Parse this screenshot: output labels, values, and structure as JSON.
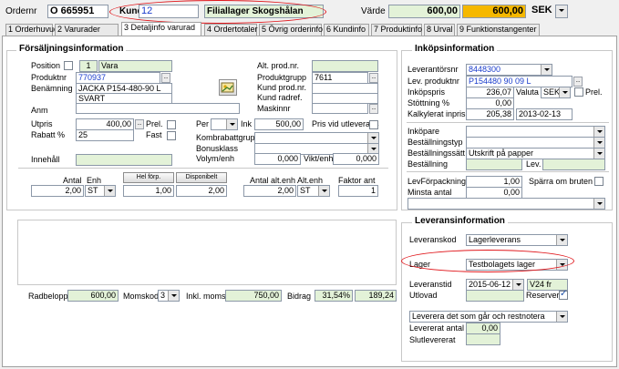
{
  "header": {
    "ordernr_label": "Ordernr",
    "ordernr_value": "O  665951",
    "kund_label": "Kund",
    "kund_value": "12",
    "kund_name": "Filiallager Skogshålan",
    "varde_label": "Värde",
    "varde_value": "600,00",
    "varde_value2": "600,00",
    "currency": "SEK"
  },
  "tabs": [
    "1 Orderhuvud",
    "2 Varurader",
    "3 Detaljinfo varurad",
    "4 Ordertotaler",
    "5 Övrig orderinfo",
    "6 Kundinfo",
    "7 Produktinfo",
    "8 Urval",
    "9 Funktionstangenter"
  ],
  "forsaljning": {
    "title": "Försäljningsinformation",
    "position_label": "Position",
    "position_value": "1",
    "position_type": "Vara",
    "produktnr_label": "Produktnr",
    "produktnr_value": "770937",
    "benamning_label": "Benämning",
    "benamning_line1": "JACKA  P154-480-90  L",
    "benamning_line2": "SVART",
    "anm_label": "Anm",
    "alt_prod_label": "Alt. prod.nr.",
    "produktgrupp_label": "Produktgrupp",
    "produktgrupp_value": "7611",
    "kund_prod_label": "Kund prod.nr.",
    "kund_radref_label": "Kund radref.",
    "maskinnr_label": "Maskinnr",
    "utpris_label": "Utpris",
    "utpris_value": "400,00",
    "prel_label": "Prel.",
    "fast_label": "Fast",
    "rabatt_label": "Rabatt %",
    "rabatt_value": "25",
    "per_label": "Per",
    "ink_label": "Ink",
    "ink_value": "500,00",
    "pris_utl_label": "Pris vid utleverans",
    "kombrabattgrupp_label": "Kombrabattgrupp",
    "bonusklass_label": "Bonusklass",
    "volym_label": "Volym/enh",
    "volym_value": "0,000",
    "vikt_label": "Vikt/enh",
    "vikt_value": "0,000",
    "innehall_label": "Innehåll",
    "antal_label": "Antal",
    "enh_label": "Enh",
    "hel_forp_label": "Hel förp.",
    "disponibelt_label": "Disponibelt",
    "antal_value": "2,00",
    "enh_value": "ST",
    "hel_forp_value": "1,00",
    "disponibelt_value": "2,00",
    "antal_alt_label": "Antal alt.enh",
    "alt_enh_label": "Alt.enh",
    "faktor_label": "Faktor ant",
    "antal_alt_value": "2,00",
    "alt_enh_value": "ST",
    "faktor_value": "1"
  },
  "inkop": {
    "title": "Inköpsinformation",
    "leverantorsnr_label": "Leverantörsnr",
    "leverantorsnr_value": "8448300",
    "lev_produktnr_label": "Lev. produktnr",
    "lev_produktnr_value": "P154480  90 09  L",
    "inkopspris_label": "Inköpspris",
    "inkopspris_value": "236,07",
    "valuta_label": "Valuta",
    "valuta_value": "SEK",
    "prel_label": "Prel.",
    "stottning_label": "Stöttning %",
    "stottning_value": "0,00",
    "kalkylerat_label": "Kalkylerat inpris",
    "kalkylerat_value": "205,38",
    "kalkylerat_date": "2013-02-13",
    "inkopare_label": "Inköpare",
    "bestallningstyp_label": "Beställningstyp",
    "bestallningssatt_label": "Beställningssätt",
    "bestallningssatt_value": "Utskrift på papper",
    "bestallning_label": "Beställning",
    "lev_label": "Lev.",
    "levforpackning_label": "LevFörpackning",
    "levforpackning_value": "1,00",
    "sparra_label": "Spärra om bruten",
    "minsta_antal_label": "Minsta antal",
    "minsta_antal_value": "0,00"
  },
  "totals": {
    "radbelopp_label": "Radbelopp",
    "radbelopp_value": "600,00",
    "momskod_label": "Momskod",
    "momskod_value": "3",
    "inkl_moms_label": "Inkl. moms",
    "inkl_moms_value": "750,00",
    "bidrag_label": "Bidrag",
    "bidrag_pct": "31,54%",
    "bidrag_value": "189,24"
  },
  "leverans": {
    "title": "Leveransinformation",
    "leveranskod_label": "Leveranskod",
    "leveranskod_value": "Lagerleverans",
    "lager_label": "Lager",
    "lager_value": "Testbolagets lager",
    "leveranstid_label": "Leveranstid",
    "leveranstid_value": "2015-06-12",
    "week_value": "V24 fr",
    "utlovad_label": "Utlovad",
    "reserveras_label": "Reserveras",
    "leverera_option": "Leverera det som går och restnotera",
    "levererat_antal_label": "Levererat antal",
    "levererat_antal_value": "0,00",
    "slutlevererat_label": "Slutlevererat"
  },
  "colors": {
    "field_green": "#e3f2d8",
    "value_yellow": "#f5b800",
    "highlight_red": "#e0161b",
    "link_blue": "#1a3ccc"
  }
}
